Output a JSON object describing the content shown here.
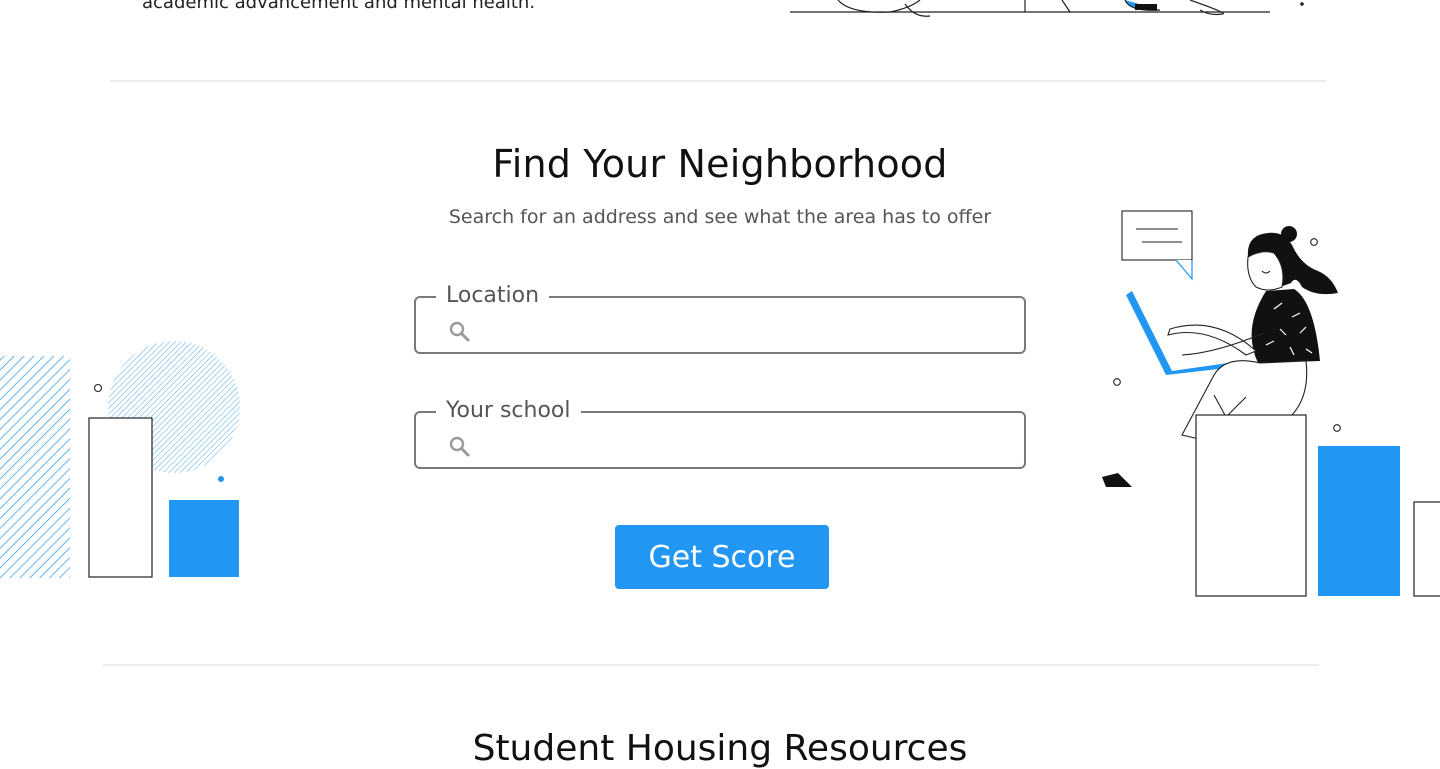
{
  "intro": {
    "tail_text": "academic advancement and mental health."
  },
  "search_section": {
    "title": "Find Your Neighborhood",
    "subtitle": "Search for an address and see what the area has to offer",
    "location_field": {
      "label": "Location",
      "value": "",
      "placeholder": ""
    },
    "school_field": {
      "label": "Your school",
      "value": "",
      "placeholder": ""
    },
    "submit_label": "Get Score",
    "icons": [
      "search-icon",
      "search-icon"
    ]
  },
  "next_section": {
    "title": "Student Housing Resources"
  },
  "colors": {
    "accent": "#2196f3",
    "field_border": "#7a7a7a",
    "divider": "#ececec"
  }
}
